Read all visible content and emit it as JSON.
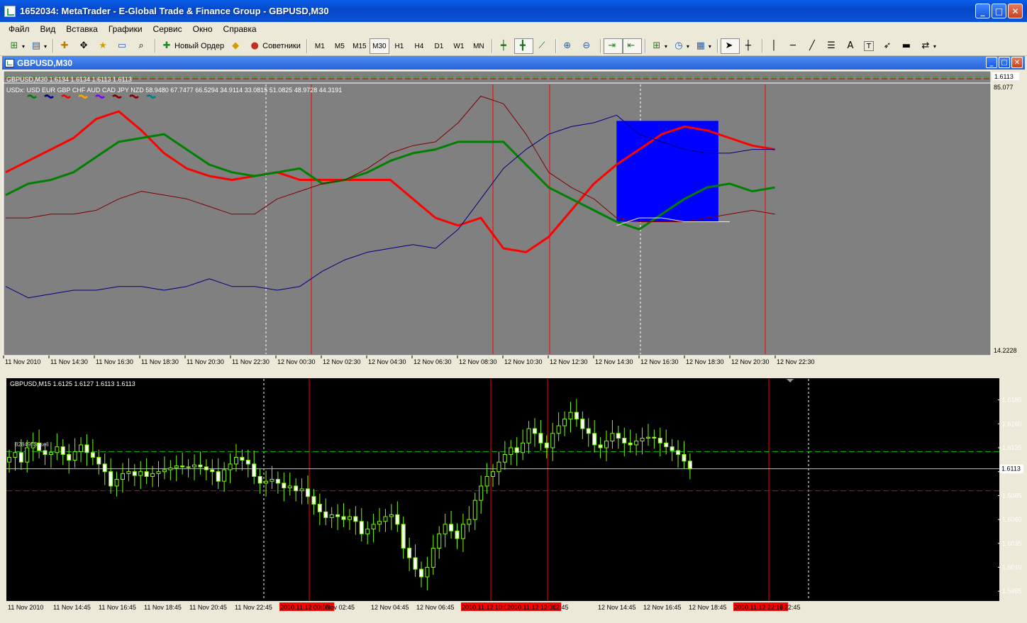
{
  "window": {
    "title": "1652034: MetaTrader - E-Global Trade & Finance Group - GBPUSD,M30",
    "minimize": "_",
    "maximize": "□",
    "close": "✕"
  },
  "menu": [
    "Файл",
    "Вид",
    "Вставка",
    "Графики",
    "Сервис",
    "Окно",
    "Справка"
  ],
  "toolbar": {
    "new_order": "Новый Ордер",
    "advisors": "Советники",
    "timeframes": [
      "M1",
      "M5",
      "M15",
      "M30",
      "H1",
      "H4",
      "D1",
      "W1",
      "MN"
    ],
    "active_timeframe": "M30",
    "icons": [
      "new-chart-icon",
      "profiles-icon",
      "market-watch-icon",
      "navigator-icon",
      "favorites-icon",
      "terminal-icon",
      "tester-icon",
      "new-order-icon",
      "metaeditor-icon",
      "expert-advisors-icon",
      "bar-chart-icon",
      "candlestick-icon",
      "line-chart-icon",
      "zoom-in-icon",
      "zoom-out-icon",
      "auto-scroll-icon",
      "chart-shift-icon",
      "indicators-icon",
      "periods-icon",
      "templates-icon",
      "cursor-icon",
      "crosshair-icon",
      "vertical-line-icon",
      "horizontal-line-icon",
      "trendline-icon",
      "fibonacci-icon",
      "text-icon",
      "text-label-icon",
      "arrow-icon",
      "rectangle-icon",
      "arrows-menu-icon"
    ],
    "text_tool": "A",
    "label_tool": "T"
  },
  "child_window": {
    "title": "GBPUSD,M30",
    "minimize": "_",
    "maximize": "□",
    "close": "✕"
  },
  "chart_data": [
    {
      "type": "line",
      "title": "GBPUSD,M30  1.6134 1.6134 1.6113 1.6113",
      "subtitle": "USDx: USD EUR GBP CHF AUD CAD JPY NZD 58.9480 67.7477 66.5294 34.9114 33.0815 51.0825 48.9728 44.3191",
      "legend": [
        "USD",
        "EUR",
        "GBP",
        "CHF",
        "AUD",
        "CAD",
        "JPY",
        "NZD"
      ],
      "legend_colors": [
        "#008000",
        "#000080",
        "#FF0000",
        "#FFA500",
        "#8000FF",
        "#800000",
        "#8B0000",
        "#008080"
      ],
      "price_tag": "1.6113",
      "ylim": [
        14.2228,
        85.077
      ],
      "ytick_labels": [
        "85.077",
        "14.2228"
      ],
      "x_labels": [
        "11 Nov 2010",
        "11 Nov 14:30",
        "11 Nov 16:30",
        "11 Nov 18:30",
        "11 Nov 20:30",
        "11 Nov 22:30",
        "12 Nov 00:30",
        "12 Nov 02:30",
        "12 Nov 04:30",
        "12 Nov 06:30",
        "12 Nov 08:30",
        "12 Nov 10:30",
        "12 Nov 12:30",
        "12 Nov 14:30",
        "12 Nov 16:30",
        "12 Nov 18:30",
        "12 Nov 20:30",
        "12 Nov 22:30"
      ],
      "background": "#808080",
      "series": [
        {
          "name": "GBP",
          "color": "#FF0000",
          "width": 3,
          "x": [
            0,
            1,
            2,
            3,
            4,
            5,
            6,
            7,
            8,
            9,
            10,
            11,
            12,
            13,
            14,
            15,
            16,
            17,
            18,
            19,
            20,
            21,
            22,
            23,
            24,
            25,
            26,
            27,
            28,
            29,
            30,
            31,
            32,
            33,
            34
          ],
          "values": [
            62,
            65,
            68,
            71,
            76,
            78,
            73,
            67,
            63,
            61,
            60,
            61,
            62,
            60,
            60,
            60,
            60,
            60,
            55,
            50,
            48,
            50,
            42,
            41,
            45,
            52,
            59,
            64,
            68,
            72,
            74,
            73,
            71,
            69,
            68
          ]
        },
        {
          "name": "USD",
          "color": "#008000",
          "width": 3,
          "x": [
            0,
            1,
            2,
            3,
            4,
            5,
            6,
            7,
            8,
            9,
            10,
            11,
            12,
            13,
            14,
            15,
            16,
            17,
            18,
            19,
            20,
            21,
            22,
            23,
            24,
            25,
            26,
            27,
            28,
            29,
            30,
            31,
            32,
            33,
            34
          ],
          "values": [
            56,
            59,
            60,
            62,
            66,
            70,
            71,
            72,
            68,
            64,
            62,
            61,
            62,
            63,
            59,
            60,
            62,
            65,
            67,
            68,
            70,
            70,
            70,
            64,
            58,
            55,
            52,
            49,
            47,
            51,
            55,
            58,
            59,
            57,
            58
          ]
        },
        {
          "name": "EUR",
          "color": "#000080",
          "width": 1,
          "x": [
            0,
            1,
            2,
            3,
            4,
            5,
            6,
            7,
            8,
            9,
            10,
            11,
            12,
            13,
            14,
            15,
            16,
            17,
            18,
            19,
            20,
            21,
            22,
            23,
            24,
            25,
            26,
            27,
            28,
            29,
            30,
            31,
            32,
            33,
            34
          ],
          "values": [
            32,
            29,
            30,
            31,
            31,
            32,
            32,
            31,
            32,
            34,
            32,
            32,
            31,
            32,
            36,
            39,
            41,
            42,
            43,
            42,
            47,
            55,
            63,
            68,
            72,
            74,
            75,
            77,
            72,
            70,
            68,
            67,
            67,
            68,
            68
          ]
        },
        {
          "name": "CAD",
          "color": "#800000",
          "width": 1,
          "x": [
            0,
            1,
            2,
            3,
            4,
            5,
            6,
            7,
            8,
            9,
            10,
            11,
            12,
            13,
            14,
            15,
            16,
            17,
            18,
            19,
            20,
            21,
            22,
            23,
            24,
            25,
            26,
            27,
            28,
            29,
            30,
            31,
            32,
            33,
            34
          ],
          "values": [
            50,
            50,
            51,
            51,
            52,
            55,
            57,
            56,
            55,
            53,
            51,
            51,
            55,
            57,
            59,
            60,
            63,
            67,
            69,
            70,
            75,
            82,
            80,
            72,
            62,
            58,
            55,
            50,
            49,
            49,
            49,
            50,
            51,
            52,
            51
          ]
        },
        {
          "name": "AUD",
          "color": "#E8E8E8",
          "width": 1,
          "x": [
            27,
            28,
            29,
            30,
            31,
            32
          ],
          "values": [
            48,
            50,
            50,
            49,
            49,
            49
          ]
        }
      ]
    },
    {
      "type": "candlestick",
      "title": "GBPUSD,M15  1.6125 1.6127 1.6113 1.6113",
      "annotation": "8284953: sell",
      "ylim": [
        1.5977,
        1.6204
      ],
      "ytick_labels": [
        "1.6185",
        "1.6160",
        "1.6135",
        "1.6110",
        "1.6085",
        "1.6060",
        "1.6035",
        "1.6010",
        "1.5985"
      ],
      "price_tag": "1.6113",
      "levels": {
        "order": 1.6131,
        "bid": 1.6113,
        "stop": 1.609
      },
      "x_labels": [
        "11 Nov 2010",
        "11 Nov 14:45",
        "11 Nov 16:45",
        "11 Nov 18:45",
        "11 Nov 20:45",
        "11 Nov 22:45",
        "2010.11.12 00:00",
        "Nov 02:45",
        "12 Nov 04:45",
        "12 Nov 06:45",
        "2010.11.12 10:00",
        "2010.11.12 12:30",
        "12:45",
        "12 Nov 14:45",
        "12 Nov 16:45",
        "12 Nov 18:45",
        "2010.11.12 22:15",
        "v 22:45"
      ],
      "x_labels_highlighted": [
        6,
        10,
        11,
        16
      ],
      "candle_color": "#7CFC00",
      "close": [
        1.6125,
        1.613,
        1.612,
        1.6135,
        1.614,
        1.6132,
        1.6128,
        1.613,
        1.6136,
        1.6128,
        1.6122,
        1.6131,
        1.6138,
        1.613,
        1.6125,
        1.6118,
        1.611,
        1.6095,
        1.6102,
        1.6108,
        1.611,
        1.6106,
        1.611,
        1.6105,
        1.6108,
        1.611,
        1.6112,
        1.6114,
        1.6116,
        1.6115,
        1.6115,
        1.6117,
        1.6115,
        1.6112,
        1.611,
        1.61,
        1.6112,
        1.6118,
        1.6125,
        1.6122,
        1.6118,
        1.6105,
        1.6098,
        1.61,
        1.6102,
        1.6098,
        1.6093,
        1.6095,
        1.609,
        1.6092,
        1.6084,
        1.6076,
        1.6068,
        1.6062,
        1.6065,
        1.6063,
        1.606,
        1.6063,
        1.6058,
        1.6045,
        1.605,
        1.6055,
        1.6058,
        1.6063,
        1.6065,
        1.6055,
        1.603,
        1.602,
        1.6008,
        1.6,
        1.601,
        1.603,
        1.6045,
        1.6055,
        1.6048,
        1.604,
        1.6055,
        1.606,
        1.608,
        1.6095,
        1.6105,
        1.611,
        1.612,
        1.6128,
        1.6135,
        1.613,
        1.614,
        1.6155,
        1.615,
        1.614,
        1.6135,
        1.615,
        1.6158,
        1.6165,
        1.6172,
        1.6165,
        1.6155,
        1.615,
        1.6138,
        1.6135,
        1.6142,
        1.615,
        1.6145,
        1.614,
        1.6138,
        1.6142,
        1.6145,
        1.6146,
        1.6145,
        1.614,
        1.6136,
        1.6132,
        1.6128,
        1.6121,
        1.6113
      ],
      "open": [
        1.612,
        1.6125,
        1.613,
        1.612,
        1.6135,
        1.614,
        1.6132,
        1.6128,
        1.613,
        1.6136,
        1.6128,
        1.6122,
        1.6131,
        1.6138,
        1.613,
        1.6125,
        1.6118,
        1.611,
        1.6095,
        1.6102,
        1.6108,
        1.611,
        1.6106,
        1.611,
        1.6105,
        1.6108,
        1.611,
        1.6112,
        1.6114,
        1.6116,
        1.6115,
        1.6115,
        1.6117,
        1.6115,
        1.6112,
        1.611,
        1.61,
        1.6112,
        1.6118,
        1.6125,
        1.6122,
        1.6118,
        1.6105,
        1.6098,
        1.61,
        1.6102,
        1.6098,
        1.6093,
        1.6095,
        1.609,
        1.6092,
        1.6084,
        1.6076,
        1.6068,
        1.6062,
        1.6065,
        1.6063,
        1.606,
        1.6063,
        1.6058,
        1.6045,
        1.605,
        1.6055,
        1.6058,
        1.6063,
        1.6065,
        1.6055,
        1.603,
        1.602,
        1.6008,
        1.6,
        1.601,
        1.603,
        1.6045,
        1.6055,
        1.6048,
        1.604,
        1.6055,
        1.606,
        1.608,
        1.6095,
        1.6105,
        1.611,
        1.612,
        1.6128,
        1.6135,
        1.613,
        1.614,
        1.6155,
        1.615,
        1.614,
        1.6135,
        1.615,
        1.6158,
        1.6165,
        1.6172,
        1.6165,
        1.6155,
        1.615,
        1.6138,
        1.6135,
        1.6142,
        1.615,
        1.6145,
        1.614,
        1.6138,
        1.6142,
        1.6145,
        1.6146,
        1.6145,
        1.614,
        1.6136,
        1.6132,
        1.6128,
        1.6121
      ]
    }
  ]
}
